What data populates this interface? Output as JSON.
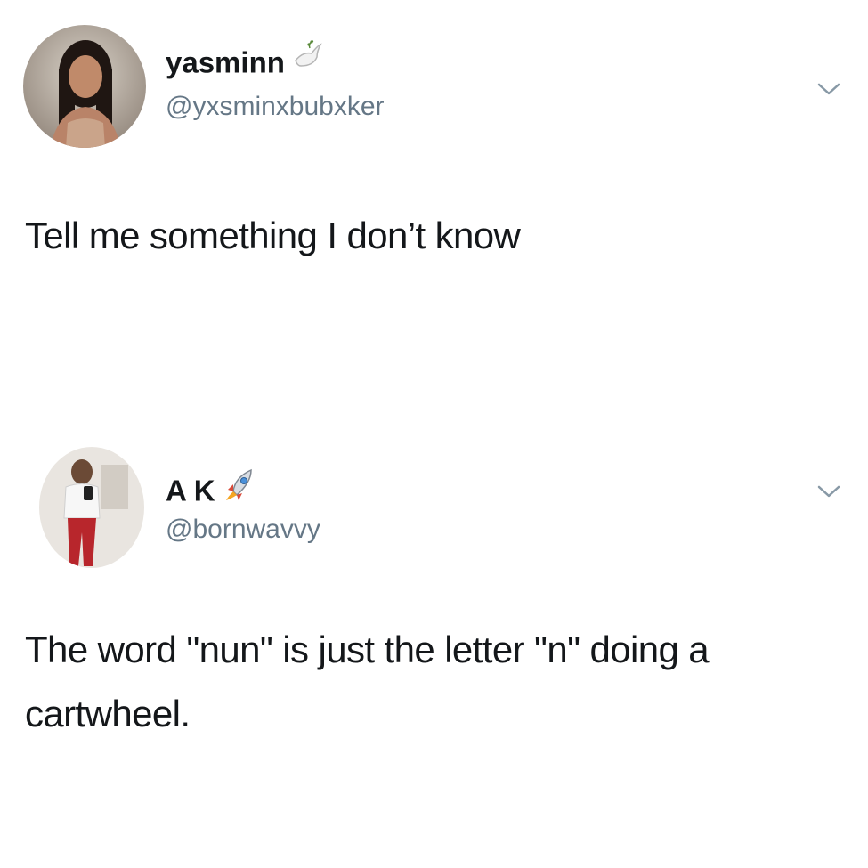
{
  "tweets": [
    {
      "display_name": "yasminn",
      "name_emoji_icon": "dove-icon",
      "handle": "@yxsminxbubxker",
      "text": "Tell me something I don’t know",
      "menu_icon": "chevron-down-icon"
    },
    {
      "display_name": "A K",
      "name_emoji_icon": "rocket-icon",
      "handle": "@bornwavvy",
      "text": "The word \"nun\" is just the letter \"n\" doing a cartwheel.",
      "menu_icon": "chevron-down-icon"
    }
  ],
  "colors": {
    "text_primary": "#14171a",
    "text_secondary": "#657786",
    "background": "#ffffff",
    "chevron": "#8899a6"
  }
}
